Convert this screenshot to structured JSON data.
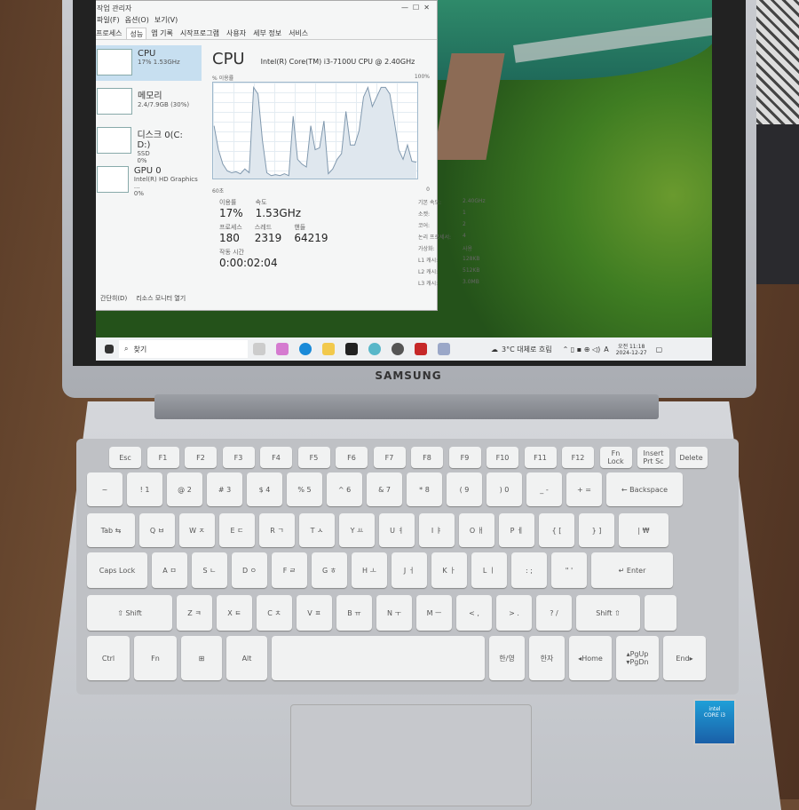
{
  "task_manager": {
    "title": "작업 관리자",
    "menu": [
      "파일(F)",
      "옵션(O)",
      "보기(V)"
    ],
    "tabs": [
      "프로세스",
      "성능",
      "앱 기록",
      "시작프로그램",
      "사용자",
      "세부 정보",
      "서비스"
    ],
    "active_tab": "성능",
    "sidebar": [
      {
        "name": "CPU",
        "sub": "17% 1.53GHz",
        "sub2": ""
      },
      {
        "name": "메모리",
        "sub": "2.4/7.9GB (30%)",
        "sub2": ""
      },
      {
        "name": "디스크 0(C: D:)",
        "sub": "SSD",
        "sub2": "0%"
      },
      {
        "name": "GPU 0",
        "sub": "Intel(R) HD Graphics ...",
        "sub2": "0%"
      }
    ],
    "heading": "CPU",
    "model": "Intel(R) Core(TM) i3-7100U CPU @ 2.40GHz",
    "graph_label": "% 이용률",
    "graph_max": "100%",
    "graph_time": "60초",
    "graph_min": "0",
    "cpu_history": [
      55,
      30,
      15,
      8,
      6,
      7,
      5,
      10,
      6,
      95,
      88,
      40,
      6,
      3,
      4,
      3,
      5,
      3,
      65,
      20,
      15,
      12,
      55,
      30,
      32,
      60,
      5,
      10,
      20,
      26,
      70,
      35,
      35,
      50,
      85,
      95,
      75,
      85,
      95,
      95,
      88,
      60,
      30,
      20,
      35,
      18,
      17
    ],
    "stats": {
      "util_label": "이용률",
      "util": "17%",
      "speed_label": "속도",
      "speed": "1.53GHz",
      "proc_label": "프로세스",
      "proc": "180",
      "thread_label": "스레드",
      "thread": "2319",
      "handle_label": "핸들",
      "handle": "64219",
      "uptime_label": "작동 시간",
      "uptime": "0:00:02:04"
    },
    "specs": [
      [
        "기본 속도:",
        "2.40GHz"
      ],
      [
        "소켓:",
        "1"
      ],
      [
        "코어:",
        "2"
      ],
      [
        "논리 프로세서:",
        "4"
      ],
      [
        "가상화:",
        "사용"
      ],
      [
        "L1 캐시:",
        "128KB"
      ],
      [
        "L2 캐시:",
        "512KB"
      ],
      [
        "L3 캐시:",
        "3.0MB"
      ]
    ],
    "footer": [
      "간단히(D)",
      "리소스 모니터 열기"
    ]
  },
  "taskbar": {
    "search": "찾기",
    "weather": "3°C 대체로 흐림",
    "ime": "A",
    "time": "오전 11:18",
    "date": "2024-12-27"
  },
  "brand": "SAMSUNG",
  "intel": "intel CORE i3",
  "keyboard": {
    "rows": [
      [
        "Esc",
        "F1",
        "F2",
        "F3",
        "F4",
        "F5",
        "F6",
        "F7",
        "F8",
        "F9",
        "F10",
        "F11",
        "F12",
        "Fn\nLock",
        "Insert\nPrt Sc",
        "Delete"
      ],
      [
        "~",
        "! 1",
        "@ 2",
        "# 3",
        "$ 4",
        "% 5",
        "^ 6",
        "& 7",
        "* 8",
        "( 9",
        ") 0",
        "_ -",
        "+ =",
        "← Backspace"
      ],
      [
        "Tab ⇆",
        "Q ㅂ",
        "W ㅈ",
        "E ㄷ",
        "R ㄱ",
        "T ㅅ",
        "Y ㅛ",
        "U ㅕ",
        "I ㅑ",
        "O ㅐ",
        "P ㅔ",
        "{ [",
        "} ]",
        "| ₩"
      ],
      [
        "Caps Lock",
        "A ㅁ",
        "S ㄴ",
        "D ㅇ",
        "F ㄹ",
        "G ㅎ",
        "H ㅗ",
        "J ㅓ",
        "K ㅏ",
        "L ㅣ",
        ": ;",
        "\" '",
        "↵ Enter"
      ],
      [
        "⇧ Shift",
        "Z ㅋ",
        "X ㅌ",
        "C ㅊ",
        "V ㅍ",
        "B ㅠ",
        "N ㅜ",
        "M ㅡ",
        "< ,",
        "> .",
        "? /",
        "Shift ⇧",
        ""
      ],
      [
        "Ctrl",
        "Fn",
        "⊞",
        "Alt",
        "",
        "한/영",
        "한자",
        "◂Home",
        "▴PgUp\n▾PgDn",
        "End▸"
      ]
    ]
  }
}
